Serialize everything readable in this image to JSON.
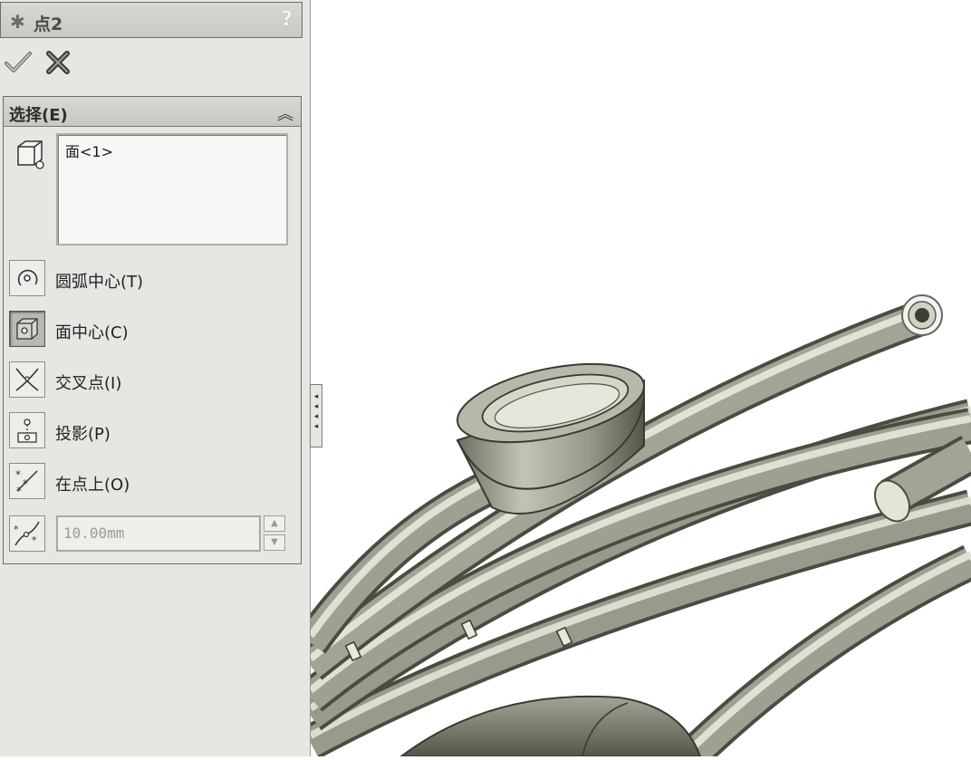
{
  "window": {
    "title_icon": "asterisk-icon",
    "title": "点2",
    "help": "?"
  },
  "actions": {
    "ok_icon": "check-icon",
    "cancel_icon": "close-icon"
  },
  "selection": {
    "header": "选择(E)",
    "collapse_icon": "double-chevron-up-icon",
    "selected_items": [
      "面<1>"
    ],
    "options": [
      {
        "label": "圆弧中心(T)",
        "icon": "arc-center-icon",
        "active": false
      },
      {
        "label": "面中心(C)",
        "icon": "face-center-icon",
        "active": true
      },
      {
        "label": "交叉点(I)",
        "icon": "intersection-icon",
        "active": false
      },
      {
        "label": "投影(P)",
        "icon": "projection-icon",
        "active": false
      },
      {
        "label": "在点上(O)",
        "icon": "on-point-icon",
        "active": false
      }
    ],
    "distance": {
      "icon": "distance-along-curve-icon",
      "value": "10.00mm"
    }
  },
  "colors": {
    "panel_bg": "#e6e6e3",
    "header_bg": "#c9c9c3",
    "model_shade": "#8e8e80",
    "model_light": "#d8d8cc",
    "model_dark": "#4a4a40"
  }
}
